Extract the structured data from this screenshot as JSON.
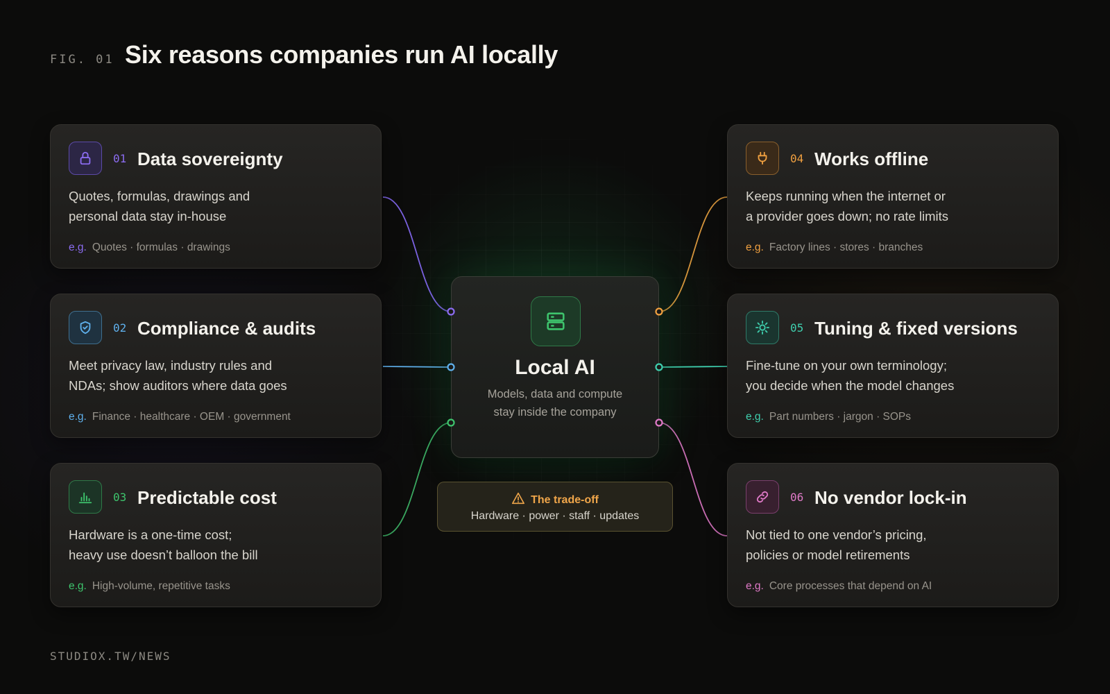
{
  "header": {
    "fig_label": "FIG. 01",
    "title": "Six reasons companies run AI locally"
  },
  "center": {
    "title": "Local AI",
    "subtitle_line1": "Models, data and compute",
    "subtitle_line2": "stay inside the company",
    "icon": "server-icon",
    "accent": "#3ec46d"
  },
  "tradeoff": {
    "label": "The trade-off",
    "text": "Hardware · power · staff · updates",
    "icon": "warning-icon",
    "accent": "#f0a64a"
  },
  "eg_label": "e.g.",
  "cards": [
    {
      "number": "01",
      "title": "Data sovereignty",
      "desc_line1": "Quotes, formulas, drawings and",
      "desc_line2": "personal data stay in-house",
      "examples": "Quotes · formulas · drawings",
      "icon": "lock-icon",
      "accent": "#8b6cf0"
    },
    {
      "number": "02",
      "title": "Compliance & audits",
      "desc_line1": "Meet privacy law, industry rules and",
      "desc_line2": "NDAs; show auditors where data goes",
      "examples": "Finance · healthcare · OEM · government",
      "icon": "shield-check-icon",
      "accent": "#5fb0ec"
    },
    {
      "number": "03",
      "title": "Predictable cost",
      "desc_line1": "Hardware is a one-time cost;",
      "desc_line2": "heavy use doesn’t balloon the bill",
      "examples": "High-volume, repetitive tasks",
      "icon": "bar-chart-icon",
      "accent": "#3ec46d"
    },
    {
      "number": "04",
      "title": "Works offline",
      "desc_line1": "Keeps running when the internet or",
      "desc_line2": "a provider goes down; no rate limits",
      "examples": "Factory lines · stores · branches",
      "icon": "plug-icon",
      "accent": "#f0a040"
    },
    {
      "number": "05",
      "title": "Tuning & fixed versions",
      "desc_line1": "Fine-tune on your own terminology;",
      "desc_line2": "you decide when the model changes",
      "examples": "Part numbers · jargon · SOPs",
      "icon": "gear-icon",
      "accent": "#3fcfae"
    },
    {
      "number": "06",
      "title": "No vendor lock-in",
      "desc_line1": "Not tied to one vendor’s pricing,",
      "desc_line2": "policies or model retirements",
      "examples": "Core processes that depend on AI",
      "icon": "link-icon",
      "accent": "#e07ac8"
    }
  ],
  "footer": {
    "text": "STUDIOX.TW/NEWS"
  }
}
